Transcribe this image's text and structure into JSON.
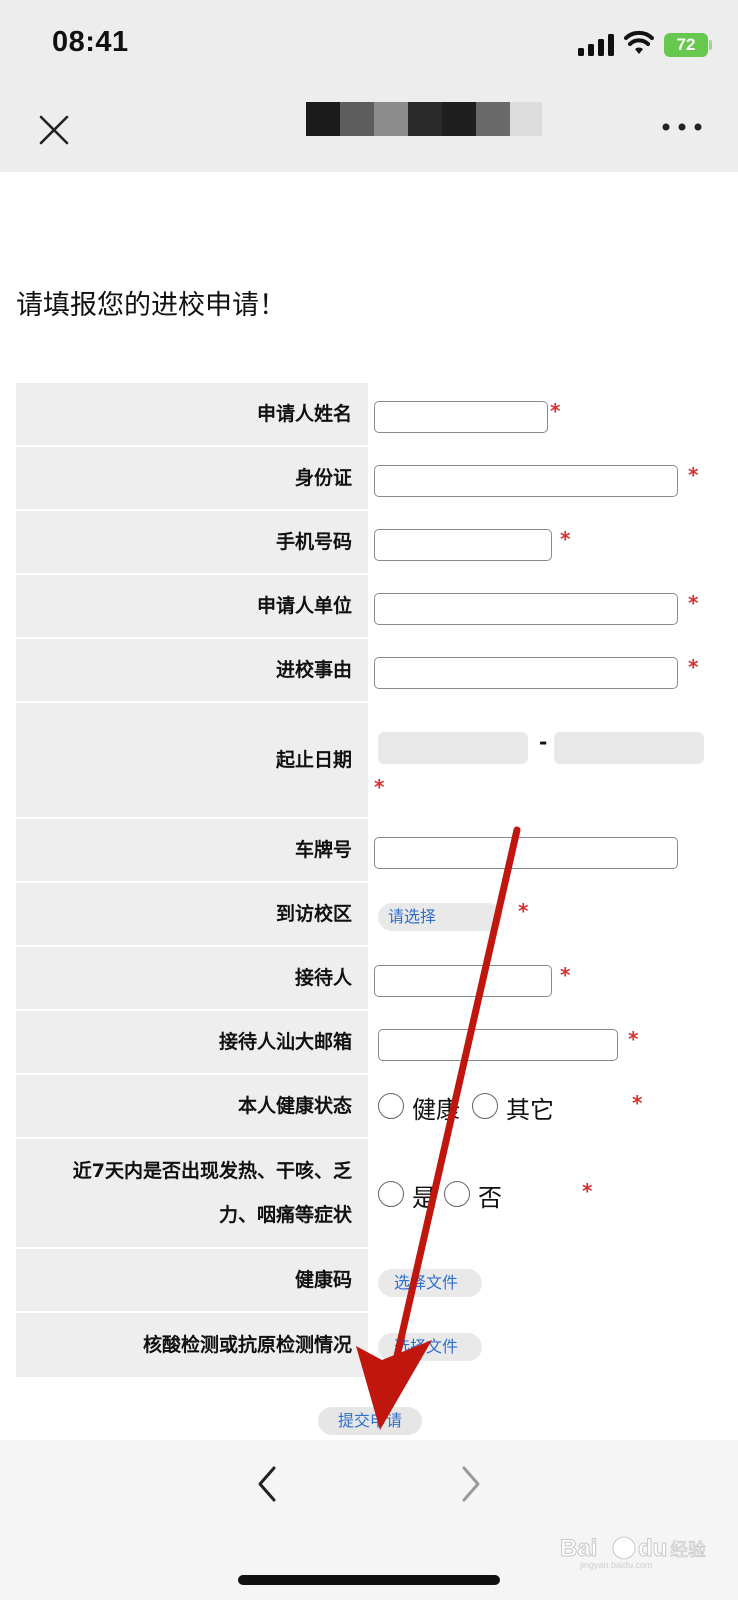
{
  "status_bar": {
    "time": "08:41",
    "battery": "72",
    "icons": [
      "signal-icon",
      "wifi-icon",
      "battery-icon"
    ]
  },
  "nav": {
    "close_icon": "close-icon",
    "more_icon": "more-icon",
    "title_redacted": true
  },
  "page": {
    "heading": "请填报您的进校申请！"
  },
  "form": {
    "required_mark": "*",
    "date_separator": "-",
    "rows": [
      {
        "label": "申请人姓名"
      },
      {
        "label": "身份证"
      },
      {
        "label": "手机号码"
      },
      {
        "label": "申请人单位"
      },
      {
        "label": "进校事由"
      },
      {
        "label": "起止日期"
      },
      {
        "label": "车牌号"
      },
      {
        "label": "到访校区",
        "select_placeholder": "请选择"
      },
      {
        "label": "接待人"
      },
      {
        "label": "接待人汕大邮箱"
      },
      {
        "label": "本人健康状态",
        "options": [
          "健康",
          "其它"
        ]
      },
      {
        "label_line1": "近7天内是否出现发热、干咳、乏",
        "label_line2": "力、咽痛等症状",
        "options": [
          "是",
          "否"
        ]
      },
      {
        "label": "健康码",
        "file_button": "选择文件"
      },
      {
        "label": "核酸检测或抗原检测情况",
        "file_button": "选择文件"
      }
    ],
    "submit_label": "提交申请"
  },
  "bottom_bar": {
    "back_icon": "chevron-left-icon",
    "forward_icon": "chevron-right-icon"
  },
  "watermark": {
    "brand": "Baidu",
    "suffix": "经验",
    "url": "jingyan.baidu.com"
  },
  "annotation": {
    "arrow_color": "#c0160e"
  }
}
